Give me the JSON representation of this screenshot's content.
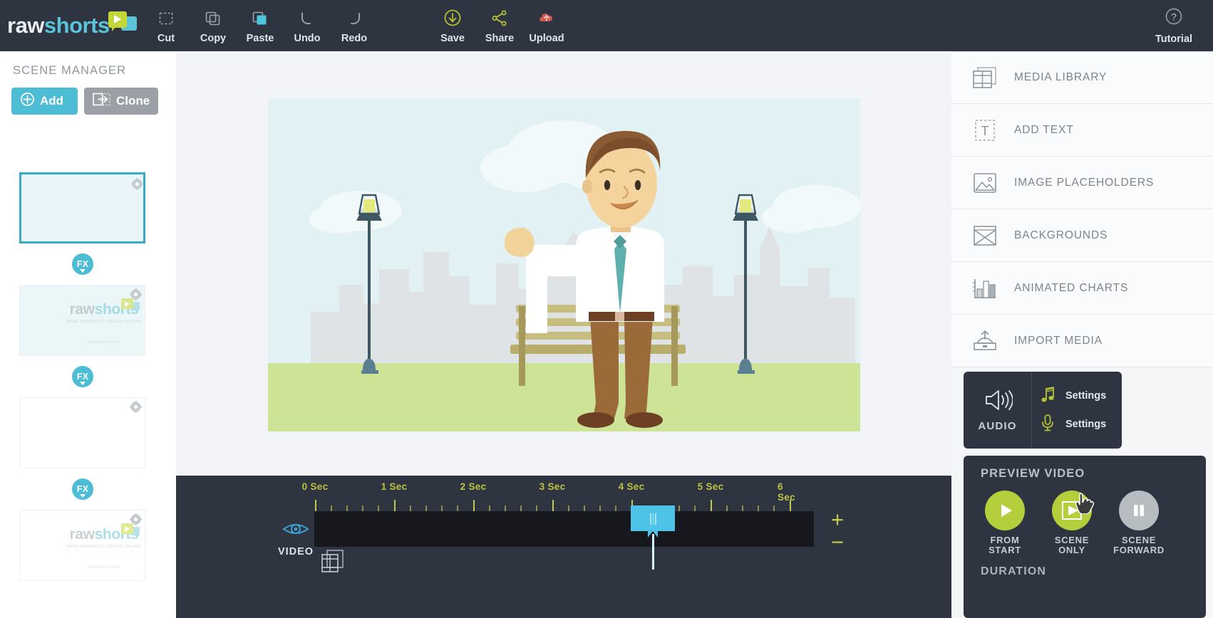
{
  "app": {
    "brand_raw": "raw",
    "brand_shorts": "shorts",
    "accent_teal": "#4dbdd6",
    "accent_green": "#b5cf3c",
    "dark": "#2e3440"
  },
  "toolbar": {
    "items": [
      {
        "label": "Cut",
        "icon": "cut-icon"
      },
      {
        "label": "Copy",
        "icon": "copy-icon"
      },
      {
        "label": "Paste",
        "icon": "paste-icon"
      },
      {
        "label": "Undo",
        "icon": "undo-icon"
      },
      {
        "label": "Redo",
        "icon": "redo-icon"
      },
      {
        "label": "Save",
        "icon": "save-icon"
      },
      {
        "label": "Share",
        "icon": "share-icon"
      },
      {
        "label": "Upload",
        "icon": "upload-icon"
      }
    ],
    "tutorial_label": "Tutorial",
    "tutorial_icon": "question-mark-icon"
  },
  "scene_manager": {
    "title": "SCENE MANAGER",
    "add_label": "Add",
    "clone_label": "Clone",
    "fx_label": "FX",
    "scenes": [
      {
        "selected": true,
        "has_logo": false
      },
      {
        "selected": false,
        "has_logo": true
      },
      {
        "selected": false,
        "has_logo": false
      },
      {
        "selected": false,
        "has_logo": true
      }
    ],
    "thumb_logo": {
      "raw": "raw",
      "shorts": "shorts",
      "sub": "MAKE ANIMATED VIDEOS ONLINE",
      "url": "rawshorts.com"
    }
  },
  "right_panel": {
    "items": [
      {
        "label": "MEDIA LIBRARY",
        "icon": "media-library-icon"
      },
      {
        "label": "ADD TEXT",
        "icon": "add-text-icon"
      },
      {
        "label": "IMAGE PLACEHOLDERS",
        "icon": "image-placeholder-icon"
      },
      {
        "label": "BACKGROUNDS",
        "icon": "backgrounds-icon"
      },
      {
        "label": "ANIMATED CHARTS",
        "icon": "animated-charts-icon"
      },
      {
        "label": "IMPORT MEDIA",
        "icon": "import-media-icon"
      }
    ],
    "audio": {
      "title": "AUDIO",
      "speaker_icon": "speaker-icon",
      "rows": [
        {
          "icon": "music-note-icon",
          "label": "Settings"
        },
        {
          "icon": "microphone-icon",
          "label": "Settings"
        }
      ]
    },
    "preview": {
      "title": "PREVIEW VIDEO",
      "duration_label": "DURATION",
      "buttons": [
        {
          "caption_1": "FROM",
          "caption_2": "START",
          "icon": "play-icon",
          "state": "green"
        },
        {
          "caption_1": "SCENE",
          "caption_2": "ONLY",
          "icon": "play-scene-icon",
          "state": "green"
        },
        {
          "caption_1": "SCENE",
          "caption_2": "FORWARD",
          "icon": "pause-icon",
          "state": "grey"
        }
      ]
    }
  },
  "timeline": {
    "video_track_label": "VIDEO",
    "eye_icon": "eye-icon",
    "film_icon": "film-strip-icon",
    "zoom_in": "+",
    "zoom_out": "−",
    "playhead_position_sec": 4.0,
    "ruler_ticks": [
      {
        "label": "0 Sec",
        "sec": 0
      },
      {
        "label": "1 Sec",
        "sec": 1
      },
      {
        "label": "2 Sec",
        "sec": 2
      },
      {
        "label": "3 Sec",
        "sec": 3
      },
      {
        "label": "4 Sec",
        "sec": 4
      },
      {
        "label": "5 Sec",
        "sec": 5
      },
      {
        "label": "6 Sec",
        "sec": 6
      }
    ]
  },
  "canvas": {
    "scene_description": "Cartoon businessman waving in a park with city skyline, two lamp posts and a bench"
  }
}
